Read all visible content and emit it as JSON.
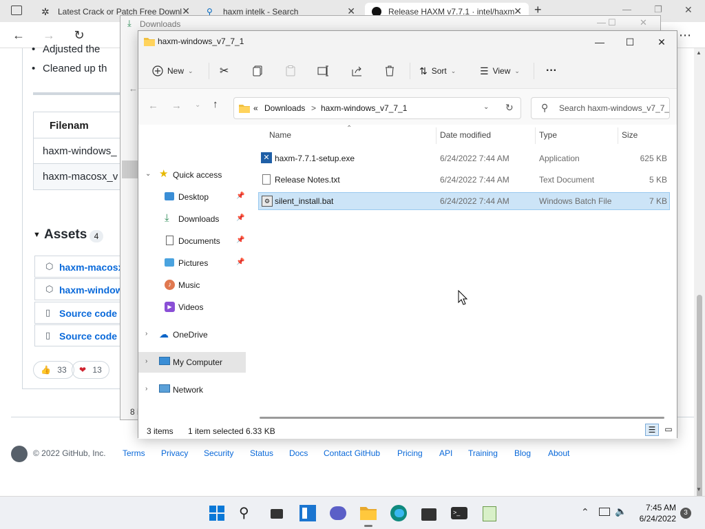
{
  "browser": {
    "tabs": [
      {
        "label": "Latest Crack or Patch Free Downl"
      },
      {
        "label": "haxm intelk - Search"
      },
      {
        "label": "Release HAXM v7.7.1 · intel/haxm"
      }
    ],
    "new_tab": "+"
  },
  "github": {
    "bullets": [
      "Adjusted the",
      "Cleaned up th"
    ],
    "table_header": "Filenam",
    "table_rows": [
      "haxm-windows_",
      "haxm-macosx_v"
    ],
    "assets_title": "Assets",
    "assets_count": "4",
    "assets": [
      "haxm-macosx",
      "haxm-window",
      "Source code",
      "Source code"
    ],
    "reactions": [
      {
        "emoji": "👍",
        "count": "33"
      },
      {
        "emoji": "❤",
        "count": "13"
      }
    ],
    "footer": {
      "copyright": "© 2022 GitHub, Inc.",
      "links": [
        "Terms",
        "Privacy",
        "Security",
        "Status",
        "Docs",
        "Contact GitHub",
        "Pricing",
        "API",
        "Training",
        "Blog",
        "About"
      ]
    }
  },
  "back_window": {
    "title": "Downloads",
    "status": "8 i"
  },
  "explorer": {
    "title": "haxm-windows_v7_7_1",
    "commands": {
      "new": "New",
      "sort": "Sort",
      "view": "View",
      "more": "···"
    },
    "address": {
      "prefix": "«",
      "crumb1": "Downloads",
      "sep": ">",
      "crumb2": "haxm-windows_v7_7_1"
    },
    "search_placeholder": "Search haxm-windows_v7_7_1",
    "nav": {
      "quick_access": "Quick access",
      "desktop": "Desktop",
      "downloads": "Downloads",
      "documents": "Documents",
      "pictures": "Pictures",
      "music": "Music",
      "videos": "Videos",
      "onedrive": "OneDrive",
      "my_computer": "My Computer",
      "network": "Network"
    },
    "columns": {
      "name": "Name",
      "date": "Date modified",
      "type": "Type",
      "size": "Size"
    },
    "files": [
      {
        "name": "haxm-7.7.1-setup.exe",
        "date": "6/24/2022 7:44 AM",
        "type": "Application",
        "size": "625 KB"
      },
      {
        "name": "Release Notes.txt",
        "date": "6/24/2022 7:44 AM",
        "type": "Text Document",
        "size": "5 KB"
      },
      {
        "name": "silent_install.bat",
        "date": "6/24/2022 7:44 AM",
        "type": "Windows Batch File",
        "size": "7 KB"
      }
    ],
    "status": {
      "items": "3 items",
      "selected": "1 item selected",
      "size": "6.33 KB"
    }
  },
  "taskbar": {
    "time": "7:45 AM",
    "date": "6/24/2022",
    "notifications": "3"
  }
}
